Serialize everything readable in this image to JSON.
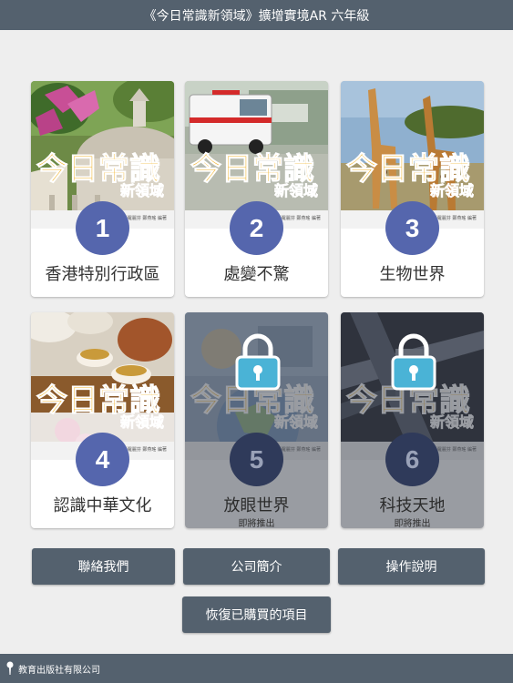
{
  "header": {
    "title": "《今日常識新領域》擴增實境AR 六年級"
  },
  "cover": {
    "logo_main": "今日常識",
    "logo_sub": "新領域",
    "publisher": "彭羅麗芬 鄭燕瑤 編著"
  },
  "books": [
    {
      "number": "1",
      "title": "香港特別行政區",
      "status": "",
      "locked": false
    },
    {
      "number": "2",
      "title": "處變不驚",
      "status": "",
      "locked": false
    },
    {
      "number": "3",
      "title": "生物世界",
      "status": "",
      "locked": false
    },
    {
      "number": "4",
      "title": "認識中華文化",
      "status": "",
      "locked": false
    },
    {
      "number": "5",
      "title": "放眼世界",
      "status": "即將推出",
      "locked": true
    },
    {
      "number": "6",
      "title": "科技天地",
      "status": "即將推出",
      "locked": true
    }
  ],
  "buttons": {
    "contact": "聯絡我們",
    "about": "公司簡介",
    "instructions": "操作說明",
    "restore": "恢復已購買的項目"
  },
  "footer": {
    "company": "教育出版社有限公司"
  },
  "colors": {
    "bar": "#54616e",
    "badge": "#5566ad",
    "background": "#eeeeee"
  }
}
